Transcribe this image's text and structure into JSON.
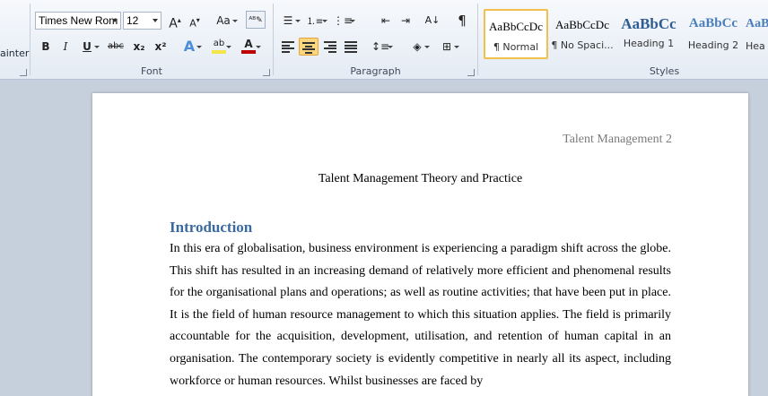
{
  "ribbon": {
    "clipboard": {
      "format_painter_label": "ainter"
    },
    "font": {
      "group_label": "Font",
      "font_name": "Times New Rom",
      "font_size": "12",
      "grow_font": "A",
      "shrink_font": "A",
      "change_case": "Aa",
      "bold": "B",
      "italic": "I",
      "underline": "U",
      "strikethrough": "abc",
      "subscript": "x₂",
      "superscript": "x²",
      "text_effects": "A",
      "font_color": "A",
      "highlight": "ab"
    },
    "paragraph": {
      "group_label": "Paragraph",
      "sort": "A↓",
      "pilcrow": "¶"
    },
    "styles": {
      "group_label": "Styles",
      "items": [
        {
          "sample": "AaBbCcDc",
          "name": "¶ Normal"
        },
        {
          "sample": "AaBbCcDc",
          "name": "¶ No Spaci..."
        },
        {
          "sample": "AaBbCc",
          "name": "Heading 1"
        },
        {
          "sample": "AaBbCc",
          "name": "Heading 2"
        },
        {
          "sample": "AaB",
          "name": "Hea"
        }
      ]
    },
    "colors": {
      "highlight": "#f2e64b",
      "font_color": "#c00000",
      "accent_heading": "#3b6aa1"
    }
  },
  "document": {
    "header": "Talent Management  2",
    "title": "Talent Management  Theory and Practice",
    "heading": "Introduction",
    "body": "In this era of globalisation, business environment is experiencing a paradigm shift across the globe. This shift has resulted in an increasing demand of relatively more efficient and phenomenal results for the organisational plans and operations; as well as routine activities; that have been put in place. It is the field of human resource management to which this situation applies. The field is primarily accountable for the acquisition, development, utilisation, and retention of human capital in an organisation. The contemporary society is evidently competitive in nearly all its aspect, including workforce or human resources. Whilst businesses are faced by"
  }
}
